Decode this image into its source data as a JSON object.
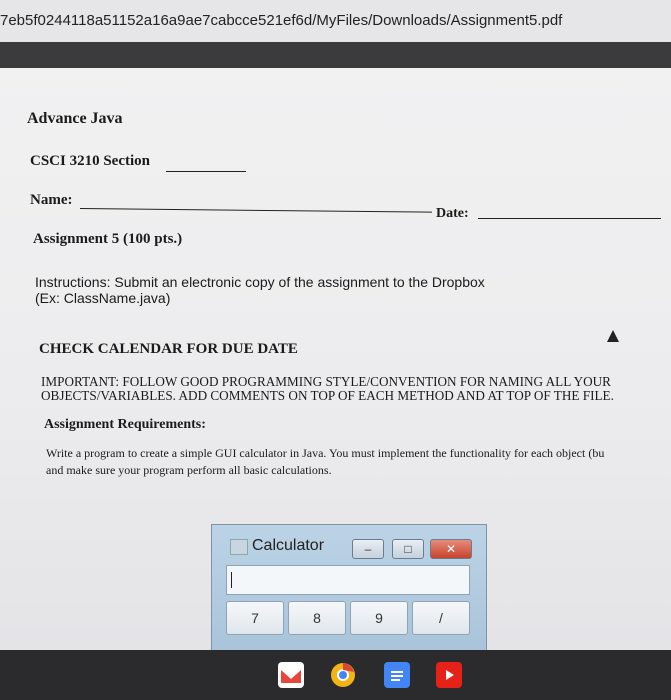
{
  "browser": {
    "url_fragment": "7eb5f0244118a51152a16a9ae7cabcce521ef6d/MyFiles/Downloads/Assignment5.pdf"
  },
  "document": {
    "course": "Advance Java",
    "section_label": "CSCI 3210 Section",
    "name_label": "Name:",
    "date_label": "Date:",
    "assignment_title": "Assignment 5 (100 pts.)",
    "instructions_line1": "Instructions: Submit an electronic copy of the assignment to the Dropbox",
    "instructions_line2": "(Ex: ClassName.java)",
    "calendar_notice": "CHECK CALENDAR FOR DUE DATE",
    "important_line1": "IMPORTANT: FOLLOW GOOD PROGRAMMING STYLE/CONVENTION FOR NAMING ALL YOUR",
    "important_line2": "OBJECTS/VARIABLES. ADD COMMENTS ON TOP OF EACH METHOD AND AT TOP OF THE FILE.",
    "requirements_heading": "Assignment Requirements:",
    "req_line1": "Write a program to create a simple GUI calculator in Java. You must implement the functionality for each object (bu",
    "req_line2": "and make sure your program perform all basic calculations."
  },
  "calculator": {
    "title": "Calculator",
    "keys": [
      "7",
      "8",
      "9",
      "/"
    ]
  },
  "taskbar": {
    "icons": [
      "gmail-icon",
      "chrome-icon",
      "docs-icon",
      "youtube-icon"
    ],
    "colors": {
      "gmail": "#e8453c",
      "chrome": "#f3b414",
      "docs": "#4285f4",
      "youtube": "#e62117"
    }
  }
}
